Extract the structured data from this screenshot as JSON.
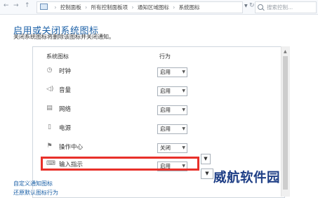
{
  "nav": {
    "back": "←",
    "forward": "→",
    "up": "↑"
  },
  "breadcrumb": {
    "items": [
      "控制面板",
      "所有控制面板项",
      "通知区域图标",
      "系统图标"
    ],
    "separator": "›"
  },
  "search": {
    "placeholder": "搜索控制..."
  },
  "page": {
    "title": "启用或关闭系统图标",
    "subtitle": "关闭系统图标将删除该图标并关闭通知。"
  },
  "table": {
    "columns": {
      "icon": "系统图标",
      "behavior": "行为"
    },
    "rows": [
      {
        "label": "时钟",
        "icon": "clock-icon",
        "value": "启用"
      },
      {
        "label": "音量",
        "icon": "volume-icon",
        "value": "启用"
      },
      {
        "label": "网络",
        "icon": "network-icon",
        "value": "启用"
      },
      {
        "label": "电源",
        "icon": "power-icon",
        "value": "启用"
      },
      {
        "label": "操作中心",
        "icon": "flag-icon",
        "value": "关闭"
      },
      {
        "label": "输入指示",
        "icon": "keyboard-icon",
        "value": "启用"
      }
    ]
  },
  "links": {
    "customize": "自定义通知图标",
    "restore": "还原默认图标行为"
  },
  "watermark": "威航软件园",
  "colors": {
    "title": "#1b60a7",
    "highlight": "#e8302a",
    "watermark": "#1f3f86"
  }
}
